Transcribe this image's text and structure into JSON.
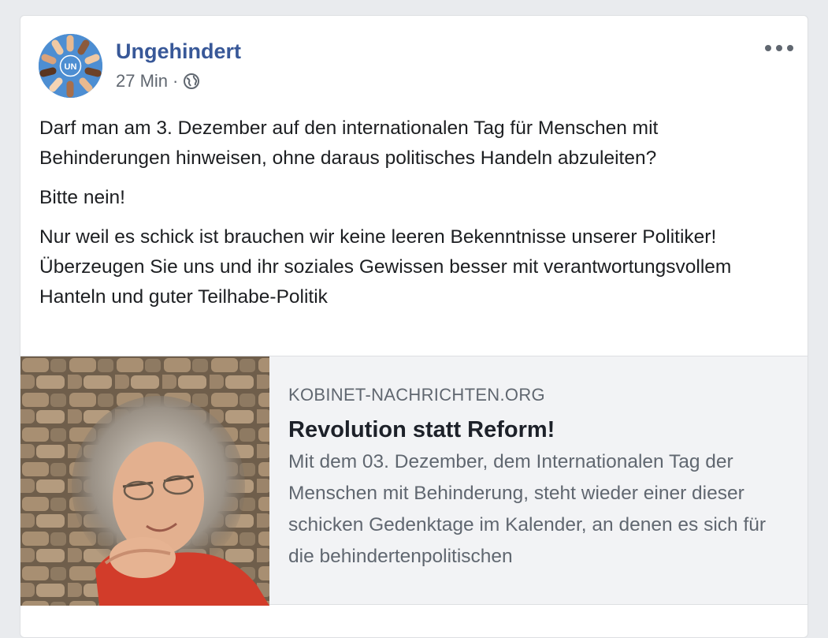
{
  "post": {
    "author": "Ungehindert",
    "time": "27 Min",
    "separator": "·",
    "privacy_icon": "globe-icon",
    "avatar_text": "UN",
    "paragraphs": [
      "Darf man am 3. Dezember auf den internationalen Tag für Menschen mit Behinderungen hinweisen, ohne daraus politisches Handeln abzuleiten?",
      "Bitte nein!"
    ],
    "paragraph3_line1": "Nur weil es schick ist brauchen wir keine leeren Bekenntnisse unserer Politiker!",
    "paragraph3_line2": "Überzeugen Sie uns und ihr soziales Gewissen besser mit verantwortungsvollem Hanteln und guter Teilhabe-Politik"
  },
  "link": {
    "domain": "KOBINET-NACHRICHTEN.ORG",
    "title": "Revolution statt Reform!",
    "description": "Mit dem 03. Dezember, dem Internationalen Tag der Menschen mit Behinderung, steht wieder einer dieser schicken Gedenktage im Kalender, an denen es sich für die behindertenpolitischen"
  },
  "colors": {
    "page_bg": "#e9ebee",
    "author_link": "#385898",
    "muted_text": "#606770",
    "preview_bg": "#f2f3f5"
  }
}
